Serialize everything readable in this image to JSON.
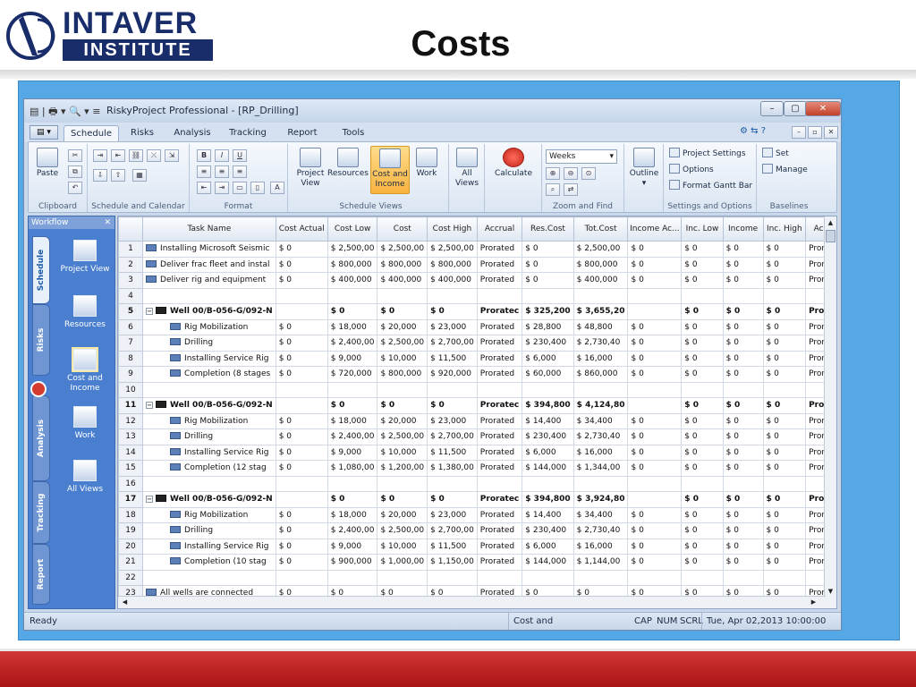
{
  "slide": {
    "logo_top": "INTAVER",
    "logo_bottom": "INSTITUTE",
    "title": "Costs"
  },
  "window": {
    "title": "RiskyProject Professional - [RP_Drilling]",
    "controls": [
      "–",
      "▢",
      "✕"
    ],
    "mdi_controls": [
      "–",
      "▫",
      "✕"
    ]
  },
  "tabs": [
    "Schedule",
    "Risks",
    "Analysis",
    "Tracking",
    "Report",
    "Tools"
  ],
  "ribbon": {
    "clipboard": {
      "paste": "Paste",
      "label": "Clipboard"
    },
    "schedule_calendar": {
      "label": "Schedule and Calendar"
    },
    "format": {
      "label": "Format",
      "bold": "B",
      "italic": "I",
      "underline": "U"
    },
    "schedule_views": {
      "label": "Schedule Views",
      "project_view": "Project View",
      "resources": "Resources",
      "cost_income": "Cost and Income",
      "work": "Work"
    },
    "all_views": "All Views",
    "calculate": "Calculate",
    "zoom": {
      "label": "Zoom and Find",
      "value": "Weeks"
    },
    "outline": "Outline",
    "settings": {
      "label": "Settings and Options",
      "project_settings": "Project Settings",
      "options": "Options",
      "format_gantt": "Format Gantt Bar"
    },
    "baselines": {
      "label": "Baselines",
      "set": "Set",
      "manage": "Manage"
    }
  },
  "workflow": {
    "title": "Workflow",
    "close": "✕",
    "vtabs": [
      "Schedule",
      "Risks",
      "Analysis",
      "Tracking",
      "Report"
    ],
    "items": [
      "Project View",
      "Resources",
      "Cost and Income",
      "Work",
      "All Views"
    ]
  },
  "grid": {
    "columns": [
      "",
      "Task Name",
      "Cost Actual",
      "Cost Low",
      "Cost",
      "Cost High",
      "Accrual",
      "Res.Cost",
      "Tot.Cost",
      "Income Ac...",
      "Inc. Low",
      "Income",
      "Inc. High",
      "Acc"
    ],
    "rows": [
      {
        "n": "1",
        "level": 0,
        "summary": false,
        "name": "Installing Microsoft Seismic",
        "c": [
          "$ 0",
          "$ 2,500,00",
          "$ 2,500,00",
          "$ 2,500,00",
          "Prorated",
          "$ 0",
          "$ 2,500,00",
          "$ 0",
          "$ 0",
          "$ 0",
          "$ 0",
          "Pror"
        ]
      },
      {
        "n": "2",
        "level": 0,
        "summary": false,
        "name": "Deliver frac fleet and instal",
        "c": [
          "$ 0",
          "$ 800,000",
          "$ 800,000",
          "$ 800,000",
          "Prorated",
          "$ 0",
          "$ 800,000",
          "$ 0",
          "$ 0",
          "$ 0",
          "$ 0",
          "Pror"
        ]
      },
      {
        "n": "3",
        "level": 0,
        "summary": false,
        "name": "Deliver rig and equipment",
        "c": [
          "$ 0",
          "$ 400,000",
          "$ 400,000",
          "$ 400,000",
          "Prorated",
          "$ 0",
          "$ 400,000",
          "$ 0",
          "$ 0",
          "$ 0",
          "$ 0",
          "Pror"
        ]
      },
      {
        "n": "4",
        "level": 0,
        "summary": false,
        "name": "",
        "c": [
          "",
          "",
          "",
          "",
          "",
          "",
          "",
          "",
          "",
          "",
          "",
          ""
        ]
      },
      {
        "n": "5",
        "level": 0,
        "summary": true,
        "name": "Well 00/B-056-G/092-N",
        "c": [
          "",
          "$ 0",
          "$ 0",
          "$ 0",
          "Proratec",
          "$ 325,200",
          "$ 3,655,20",
          "",
          "$ 0",
          "$ 0",
          "$ 0",
          "Prou"
        ]
      },
      {
        "n": "6",
        "level": 1,
        "summary": false,
        "name": "Rig Mobilization",
        "c": [
          "$ 0",
          "$ 18,000",
          "$ 20,000",
          "$ 23,000",
          "Prorated",
          "$ 28,800",
          "$ 48,800",
          "$ 0",
          "$ 0",
          "$ 0",
          "$ 0",
          "Pror"
        ]
      },
      {
        "n": "7",
        "level": 1,
        "summary": false,
        "name": "Drilling",
        "c": [
          "$ 0",
          "$ 2,400,00",
          "$ 2,500,00",
          "$ 2,700,00",
          "Prorated",
          "$ 230,400",
          "$ 2,730,40",
          "$ 0",
          "$ 0",
          "$ 0",
          "$ 0",
          "Pror"
        ]
      },
      {
        "n": "8",
        "level": 1,
        "summary": false,
        "name": "Installing Service Rig",
        "c": [
          "$ 0",
          "$ 9,000",
          "$ 10,000",
          "$ 11,500",
          "Prorated",
          "$ 6,000",
          "$ 16,000",
          "$ 0",
          "$ 0",
          "$ 0",
          "$ 0",
          "Pror"
        ]
      },
      {
        "n": "9",
        "level": 1,
        "summary": false,
        "name": "Completion (8 stages",
        "c": [
          "$ 0",
          "$ 720,000",
          "$ 800,000",
          "$ 920,000",
          "Prorated",
          "$ 60,000",
          "$ 860,000",
          "$ 0",
          "$ 0",
          "$ 0",
          "$ 0",
          "Pror"
        ]
      },
      {
        "n": "10",
        "level": 0,
        "summary": false,
        "name": "",
        "c": [
          "",
          "",
          "",
          "",
          "",
          "",
          "",
          "",
          "",
          "",
          "",
          ""
        ]
      },
      {
        "n": "11",
        "level": 0,
        "summary": true,
        "name": "Well 00/B-056-G/092-N",
        "c": [
          "",
          "$ 0",
          "$ 0",
          "$ 0",
          "Proratec",
          "$ 394,800",
          "$ 4,124,80",
          "",
          "$ 0",
          "$ 0",
          "$ 0",
          "Prou"
        ]
      },
      {
        "n": "12",
        "level": 1,
        "summary": false,
        "name": "Rig Mobilization",
        "c": [
          "$ 0",
          "$ 18,000",
          "$ 20,000",
          "$ 23,000",
          "Prorated",
          "$ 14,400",
          "$ 34,400",
          "$ 0",
          "$ 0",
          "$ 0",
          "$ 0",
          "Pror"
        ]
      },
      {
        "n": "13",
        "level": 1,
        "summary": false,
        "name": "Drilling",
        "c": [
          "$ 0",
          "$ 2,400,00",
          "$ 2,500,00",
          "$ 2,700,00",
          "Prorated",
          "$ 230,400",
          "$ 2,730,40",
          "$ 0",
          "$ 0",
          "$ 0",
          "$ 0",
          "Pror"
        ]
      },
      {
        "n": "14",
        "level": 1,
        "summary": false,
        "name": "Installing Service Rig",
        "c": [
          "$ 0",
          "$ 9,000",
          "$ 10,000",
          "$ 11,500",
          "Prorated",
          "$ 6,000",
          "$ 16,000",
          "$ 0",
          "$ 0",
          "$ 0",
          "$ 0",
          "Pror"
        ]
      },
      {
        "n": "15",
        "level": 1,
        "summary": false,
        "name": "Completion (12 stag",
        "c": [
          "$ 0",
          "$ 1,080,00",
          "$ 1,200,00",
          "$ 1,380,00",
          "Prorated",
          "$ 144,000",
          "$ 1,344,00",
          "$ 0",
          "$ 0",
          "$ 0",
          "$ 0",
          "Pror"
        ]
      },
      {
        "n": "16",
        "level": 0,
        "summary": false,
        "name": "",
        "c": [
          "",
          "",
          "",
          "",
          "",
          "",
          "",
          "",
          "",
          "",
          "",
          ""
        ]
      },
      {
        "n": "17",
        "level": 0,
        "summary": true,
        "name": "Well 00/B-056-G/092-N",
        "c": [
          "",
          "$ 0",
          "$ 0",
          "$ 0",
          "Proratec",
          "$ 394,800",
          "$ 3,924,80",
          "",
          "$ 0",
          "$ 0",
          "$ 0",
          "Prou"
        ]
      },
      {
        "n": "18",
        "level": 1,
        "summary": false,
        "name": "Rig Mobilization",
        "c": [
          "$ 0",
          "$ 18,000",
          "$ 20,000",
          "$ 23,000",
          "Prorated",
          "$ 14,400",
          "$ 34,400",
          "$ 0",
          "$ 0",
          "$ 0",
          "$ 0",
          "Pror"
        ]
      },
      {
        "n": "19",
        "level": 1,
        "summary": false,
        "name": "Drilling",
        "c": [
          "$ 0",
          "$ 2,400,00",
          "$ 2,500,00",
          "$ 2,700,00",
          "Prorated",
          "$ 230,400",
          "$ 2,730,40",
          "$ 0",
          "$ 0",
          "$ 0",
          "$ 0",
          "Pror"
        ]
      },
      {
        "n": "20",
        "level": 1,
        "summary": false,
        "name": "Installing Service Rig",
        "c": [
          "$ 0",
          "$ 9,000",
          "$ 10,000",
          "$ 11,500",
          "Prorated",
          "$ 6,000",
          "$ 16,000",
          "$ 0",
          "$ 0",
          "$ 0",
          "$ 0",
          "Pror"
        ]
      },
      {
        "n": "21",
        "level": 1,
        "summary": false,
        "name": "Completion (10 stag",
        "c": [
          "$ 0",
          "$ 900,000",
          "$ 1,000,00",
          "$ 1,150,00",
          "Prorated",
          "$ 144,000",
          "$ 1,144,00",
          "$ 0",
          "$ 0",
          "$ 0",
          "$ 0",
          "Pror"
        ]
      },
      {
        "n": "22",
        "level": 0,
        "summary": false,
        "name": "",
        "c": [
          "",
          "",
          "",
          "",
          "",
          "",
          "",
          "",
          "",
          "",
          "",
          ""
        ]
      },
      {
        "n": "23",
        "level": 0,
        "summary": false,
        "name": "All wells are connected",
        "c": [
          "$ 0",
          "$ 0",
          "$ 0",
          "$ 0",
          "Prorated",
          "$ 0",
          "$ 0",
          "$ 0",
          "$ 0",
          "$ 0",
          "$ 0",
          "Pror"
        ]
      }
    ]
  },
  "status": {
    "ready": "Ready",
    "view": "Cost and Income",
    "cap": "CAP",
    "num": "NUM",
    "scrl": "SCRL",
    "datetime": "Tue, Apr 02,2013  10:00:00 PM"
  },
  "colors": {
    "accent": "#1a2d6b",
    "stage": "#55a7e5",
    "footer": "#c62020",
    "selected": "#f7b340"
  }
}
